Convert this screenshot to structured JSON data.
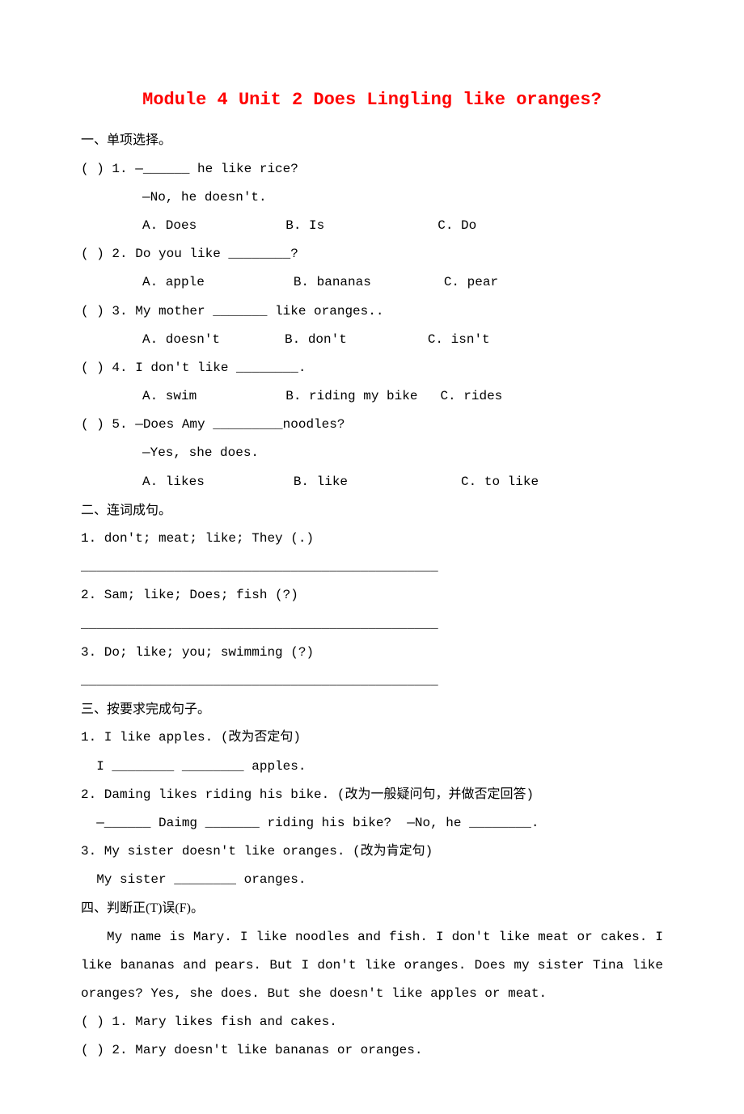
{
  "title": "Module 4 Unit 2 Does Lingling like oranges?",
  "s1": {
    "heading": "一、单项选择。",
    "q1": {
      "stem": "(    ) 1. —______ he like rice?",
      "line2": "—No, he doesn't.",
      "a": "A. Does",
      "b": "B. Is",
      "c": "C. Do"
    },
    "q2": {
      "stem": "(    ) 2. Do you like ________?",
      "a": "A. apple",
      "b": "B. bananas",
      "c": "C. pear"
    },
    "q3": {
      "stem": "(    ) 3. My mother _______ like oranges..",
      "a": "A. doesn't",
      "b": "B. don't",
      "c": "C. isn't"
    },
    "q4": {
      "stem": "(    ) 4. I don't like ________.",
      "a": "A. swim",
      "b": "B. riding my bike",
      "c": "C. rides"
    },
    "q5": {
      "stem": "(    ) 5. —Does Amy _________noodles?",
      "line2": "—Yes, she does.",
      "a": "A. likes",
      "b": "B. like",
      "c": "C. to like"
    }
  },
  "s2": {
    "heading": "二、连词成句。",
    "q1": "1. don't; meat; like; They (.)",
    "q2": "2. Sam; like; Does; fish (?)",
    "q3": "3. Do; like; you; swimming (?)",
    "blank": "______________________________________________"
  },
  "s3": {
    "heading": "三、按要求完成句子。",
    "q1a": "1. I like apples. (改为否定句)",
    "q1b": "  I ________ ________ apples.",
    "q2a": "2. Daming likes riding his bike. (改为一般疑问句，并做否定回答)",
    "q2b": "  —______ Daimg _______ riding his bike?  —No, he ________.",
    "q3a": "3. My sister doesn't like oranges.  (改为肯定句)",
    "q3b": "  My sister ________ oranges."
  },
  "s4": {
    "heading": "四、判断正(T)误(F)。",
    "passage": "My name is Mary. I like noodles and fish. I don't like meat or cakes. I like bananas and pears. But I don't like oranges. Does my sister Tina like oranges? Yes, she does. But she doesn't like apples or meat.",
    "q1": "(    ) 1. Mary likes fish and cakes.",
    "q2": "(    ) 2. Mary doesn't like bananas or oranges."
  }
}
